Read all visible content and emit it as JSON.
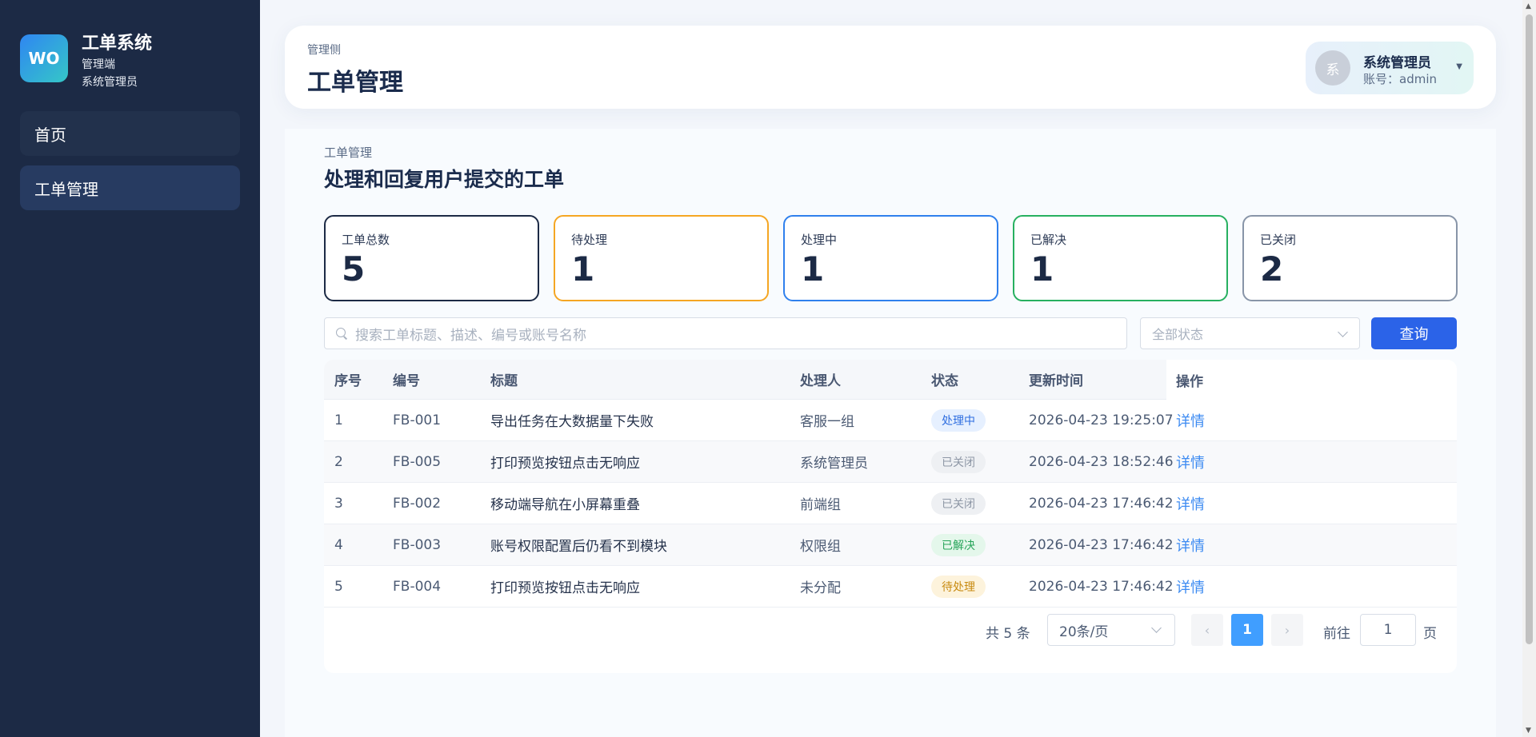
{
  "brand": {
    "logo": "WO",
    "title": "工单系统",
    "subtitle": "管理端",
    "role": "系统管理员"
  },
  "nav": [
    {
      "label": "首页",
      "active": false
    },
    {
      "label": "工单管理",
      "active": true
    }
  ],
  "header": {
    "subtitle": "管理侧",
    "title": "工单管理",
    "user": {
      "avatar_text": "系",
      "name": "系统管理员",
      "account": "账号：admin"
    }
  },
  "page": {
    "subtitle": "工单管理",
    "title": "处理和回复用户提交的工单"
  },
  "stats": [
    {
      "label": "工单总数",
      "value": "5",
      "color": "#1c2a45"
    },
    {
      "label": "待处理",
      "value": "1",
      "color": "#f5a623"
    },
    {
      "label": "处理中",
      "value": "1",
      "color": "#2f80ed"
    },
    {
      "label": "已解决",
      "value": "1",
      "color": "#27b060"
    },
    {
      "label": "已关闭",
      "value": "2",
      "color": "#8895a8"
    }
  ],
  "filters": {
    "search_placeholder": "搜索工单标题、描述、编号或账号名称",
    "status_placeholder": "全部状态",
    "query_label": "查询"
  },
  "table": {
    "columns": [
      "序号",
      "编号",
      "标题",
      "处理人",
      "状态",
      "更新时间",
      "操作"
    ],
    "rows": [
      {
        "index": "1",
        "code": "FB-001",
        "title": "导出任务在大数据量下失败",
        "assignee": "客服一组",
        "status": "处理中",
        "status_kind": "processing",
        "updated": "2026-04-23 19:25:07",
        "action": "详情"
      },
      {
        "index": "2",
        "code": "FB-005",
        "title": "打印预览按钮点击无响应",
        "assignee": "系统管理员",
        "status": "已关闭",
        "status_kind": "closed",
        "updated": "2026-04-23 18:52:46",
        "action": "详情"
      },
      {
        "index": "3",
        "code": "FB-002",
        "title": "移动端导航在小屏幕重叠",
        "assignee": "前端组",
        "status": "已关闭",
        "status_kind": "closed",
        "updated": "2026-04-23 17:46:42",
        "action": "详情"
      },
      {
        "index": "4",
        "code": "FB-003",
        "title": "账号权限配置后仍看不到模块",
        "assignee": "权限组",
        "status": "已解决",
        "status_kind": "resolved",
        "updated": "2026-04-23 17:46:42",
        "action": "详情"
      },
      {
        "index": "5",
        "code": "FB-004",
        "title": "打印预览按钮点击无响应",
        "assignee": "未分配",
        "status": "待处理",
        "status_kind": "pending",
        "updated": "2026-04-23 17:46:42",
        "action": "详情"
      }
    ]
  },
  "pagination": {
    "total": "共 5 条",
    "page_size": "20条/页",
    "prev": "‹",
    "current": "1",
    "next": "›",
    "goto_label": "前往",
    "goto_value": "1",
    "page_suffix": "页"
  },
  "colors": {
    "sidebar": "#1c2a45",
    "primary": "#2b63e8",
    "link": "#3d8bf2"
  }
}
